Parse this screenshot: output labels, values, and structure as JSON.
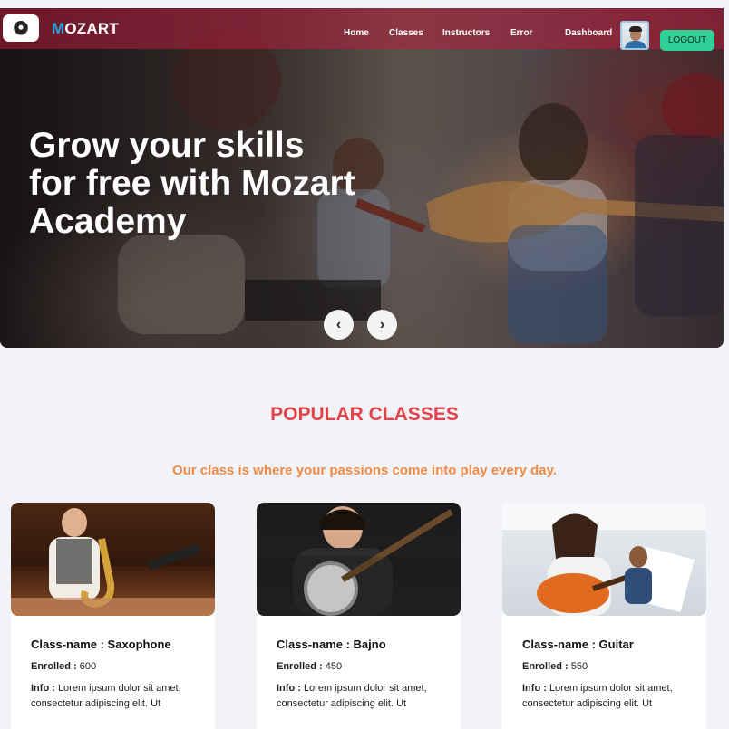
{
  "header": {
    "brand_first": "M",
    "brand_rest": "OZART",
    "nav": [
      "Home",
      "Classes",
      "Instructors",
      "Error",
      "Dashboard"
    ],
    "logout_label": "LOGOUT"
  },
  "hero": {
    "headline": "Grow your skills for free with Mozart Academy",
    "prev_label": "‹",
    "next_label": "›"
  },
  "popular": {
    "title": "POPULAR CLASSES",
    "subtitle": "Our class is where your passions come into play every day."
  },
  "cards": [
    {
      "name_label": "Class-name : ",
      "name": "Saxophone",
      "enrolled_label": "Enrolled : ",
      "enrolled": "600",
      "info_label": "Info : ",
      "info": "Lorem ipsum dolor sit amet, consectetur adipiscing elit. Ut"
    },
    {
      "name_label": "Class-name : ",
      "name": "Bajno",
      "enrolled_label": "Enrolled : ",
      "enrolled": "450",
      "info_label": "Info : ",
      "info": "Lorem ipsum dolor sit amet, consectetur adipiscing elit. Ut"
    },
    {
      "name_label": "Class-name : ",
      "name": "Guitar",
      "enrolled_label": "Enrolled : ",
      "enrolled": "550",
      "info_label": "Info : ",
      "info": "Lorem ipsum dolor sit amet, consectetur adipiscing elit. Ut"
    }
  ],
  "colors": {
    "accent_red": "#e2434b",
    "accent_orange": "#f08a45",
    "logout_green": "#2fd097",
    "brand_blue": "#2aa7e0"
  }
}
